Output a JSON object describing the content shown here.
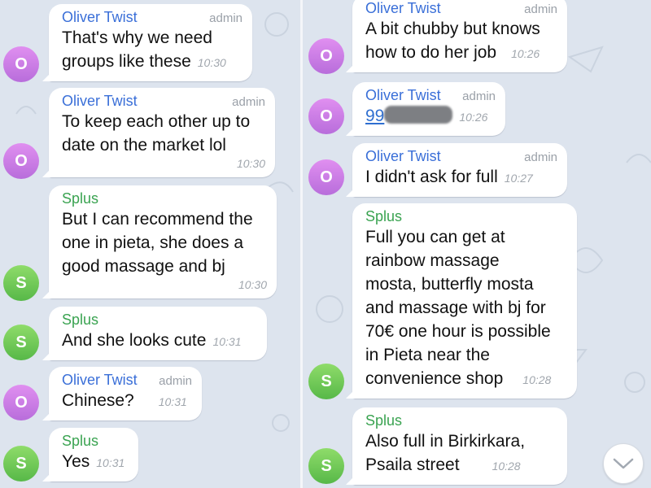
{
  "colors": {
    "background": "#dde4ee",
    "sender_oliver": "#3a6fd8",
    "sender_splus": "#3aa351",
    "avatar_oliver": "#c87ee4",
    "avatar_splus": "#6cc95a"
  },
  "left_column": [
    {
      "sender": "Oliver Twist",
      "role": "admin",
      "text": "That's why we need groups like these",
      "time": "10:30",
      "avatar": "O"
    },
    {
      "sender": "Oliver Twist",
      "role": "admin",
      "text": "To keep each other up to date on the market lol",
      "time": "10:30",
      "avatar": "O"
    },
    {
      "sender": "Splus",
      "text": "But I can recommend the one in pieta, she does a good massage and bj",
      "time": "10:30",
      "avatar": "S"
    },
    {
      "sender": "Splus",
      "text": "And she looks cute",
      "time": "10:31",
      "avatar": "S"
    },
    {
      "sender": "Oliver Twist",
      "role": "admin",
      "text": "Chinese?",
      "time": "10:31",
      "avatar": "O"
    },
    {
      "sender": "Splus",
      "text": "Yes",
      "time": "10:31",
      "avatar": "S"
    }
  ],
  "right_column": [
    {
      "sender": "Oliver Twist",
      "role": "admin",
      "text": "A bit chubby but knows how to do her job",
      "time": "10:26",
      "avatar": "O"
    },
    {
      "sender": "Oliver Twist",
      "role": "admin",
      "text": "99",
      "time": "10:26",
      "avatar": "O"
    },
    {
      "sender": "Oliver Twist",
      "role": "admin",
      "text": "I didn't ask for full",
      "time": "10:27",
      "avatar": "O"
    },
    {
      "sender": "Splus",
      "text": "Full you can get at rainbow massage mosta, butterfly mosta and massage with bj for 70€ one hour is possible in Pieta near the convenience shop",
      "time": "10:28",
      "avatar": "S"
    },
    {
      "sender": "Splus",
      "text": "Also full in Birkirkara, Psaila street",
      "time": "10:28",
      "avatar": "S"
    }
  ],
  "scroll_button": {
    "icon": "chevron-down-icon"
  }
}
